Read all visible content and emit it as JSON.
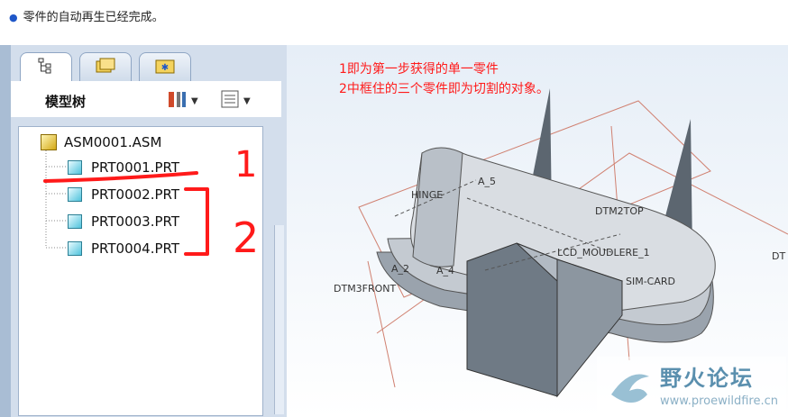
{
  "message": {
    "text": "零件的自动再生已经完成。"
  },
  "panel": {
    "title": "模型树",
    "tabs": [
      "model-tree-tab",
      "folder-browser-tab",
      "favorites-tab"
    ],
    "tree": [
      {
        "label": "ASM0001.ASM",
        "type": "assembly"
      },
      {
        "label": "PRT0001.PRT",
        "type": "part"
      },
      {
        "label": "PRT0002.PRT",
        "type": "part"
      },
      {
        "label": "PRT0003.PRT",
        "type": "part"
      },
      {
        "label": "PRT0004.PRT",
        "type": "part"
      }
    ]
  },
  "viewport": {
    "annotation_1": "1即为第一步获得的单一零件",
    "annotation_2": "2中框住的三个零件即为切割的对象。",
    "labels": {
      "hinge": "HINGE",
      "a5": "A_5",
      "dtm2top": "DTM2TOP",
      "lcd": "LCD_MOUDLERE_1",
      "a2": "A_2",
      "a4": "A_4",
      "simcard": "SIM-CARD",
      "dtm3front": "DTM3FRONT",
      "dt": "DT"
    },
    "markup_1": "1",
    "markup_2": "2"
  },
  "watermark": {
    "title": "野火论坛",
    "url": "www.proewildfire.cn"
  }
}
